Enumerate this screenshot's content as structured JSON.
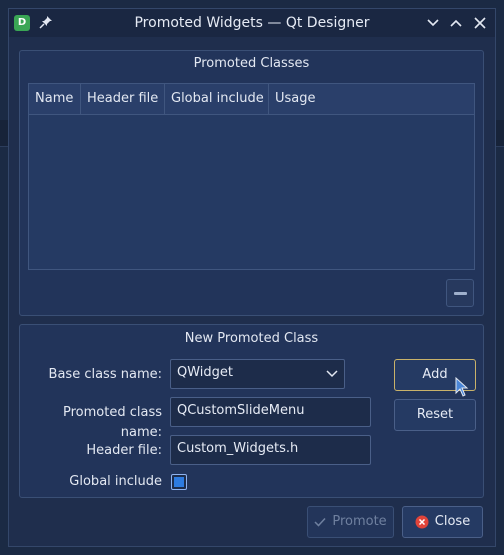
{
  "window": {
    "title": "Promoted Widgets — Qt Designer",
    "app_icon": "qt-designer-icon"
  },
  "promoted_classes": {
    "title": "Promoted Classes",
    "columns": [
      "Name",
      "Header file",
      "Global include",
      "Usage"
    ],
    "rows": []
  },
  "new_class": {
    "title": "New Promoted Class",
    "base_label": "Base class name:",
    "base_value": "QWidget",
    "promoted_label": "Promoted class name:",
    "promoted_value": "QCustomSlideMenu",
    "header_label": "Header file:",
    "header_value": "Custom_Widgets.h",
    "global_label": "Global include",
    "global_checked": true
  },
  "buttons": {
    "add": "Add",
    "reset": "Reset",
    "promote": "Promote",
    "close": "Close"
  },
  "colors": {
    "accent": "#2d7be0",
    "close_icon": "#e0443a",
    "focus_border": "#c9b26a"
  }
}
